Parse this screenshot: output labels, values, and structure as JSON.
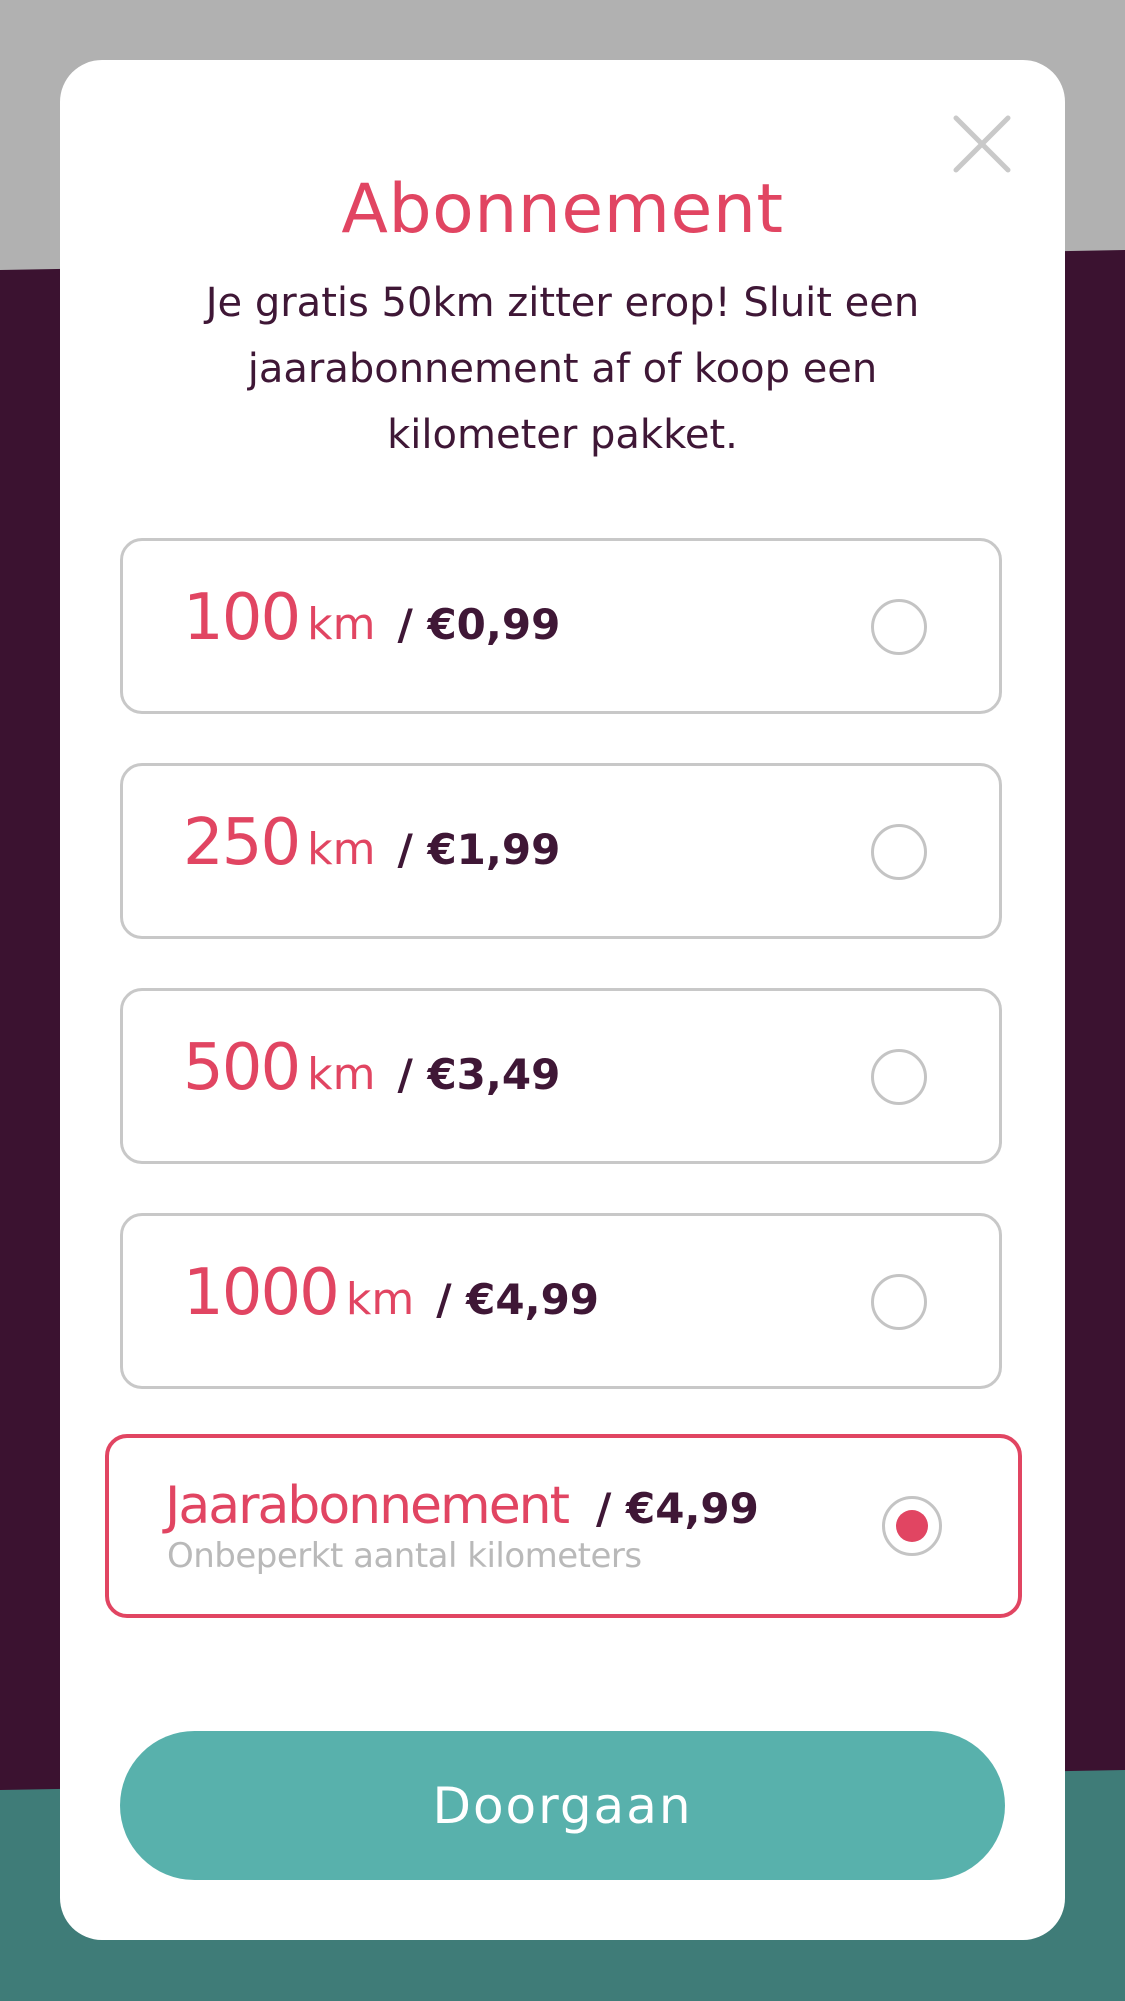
{
  "modal": {
    "title": "Abonnement",
    "subtitle": "Je gratis 50km zitter erop! Sluit een jaarabonnement af of koop een kilometer pakket.",
    "close_icon": "close-icon"
  },
  "options": [
    {
      "km": "100",
      "unit": "km",
      "price": "/ €0,99",
      "selected": false
    },
    {
      "km": "250",
      "unit": "km",
      "price": "/ €1,99",
      "selected": false
    },
    {
      "km": "500",
      "unit": "km",
      "price": "/ €3,49",
      "selected": false
    },
    {
      "km": "1000",
      "unit": "km",
      "price": "/ €4,99",
      "selected": false
    }
  ],
  "subscription": {
    "name": "Jaarabonnement",
    "price": "/ €4,99",
    "description": "Onbeperkt aantal kilometers",
    "selected": true
  },
  "continue_button": {
    "label": "Doorgaan"
  },
  "colors": {
    "accent": "#e14562",
    "text_dark": "#3f1736",
    "button": "#58b1ac",
    "backdrop_plum": "#3b1230",
    "backdrop_grey": "#b1b1b1",
    "backdrop_teal": "#3f7c78"
  }
}
